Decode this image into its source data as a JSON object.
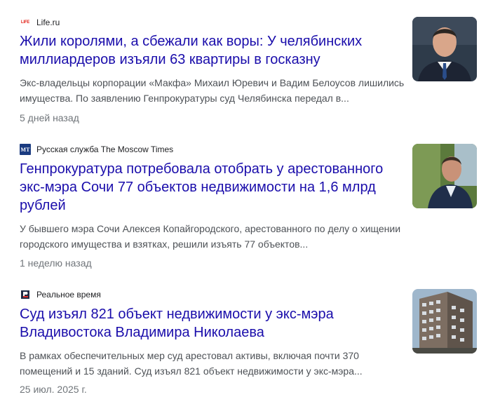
{
  "results": [
    {
      "source": "Life.ru",
      "logo_text": "LIFE",
      "title": "Жили королями, а сбежали как воры: У челябинских миллиардеров изъяли 63 квартиры в госказну",
      "snippet": "Экс-владельцы корпорации «Макфа» Михаил Юревич и Вадим Белоусов лишились имущества. По заявлению Генпрокуратуры суд Челябинска передал в...",
      "date": "5 дней назад"
    },
    {
      "source": "Русская служба The Moscow Times",
      "logo_text": "MT",
      "title": "Генпрокуратура потребовала отобрать у арестованного экс-мэра Сочи 77 объектов недвижимости на 1,6 млрд рублей",
      "snippet": "У бывшего мэра Сочи Алексея Копайгородского, арестованного по делу о хищении городского имущества и взятках, решили изъять 77 объектов...",
      "date": "1 неделю назад"
    },
    {
      "source": "Реальное время",
      "logo_text": "",
      "title": "Суд изъял 821 объект недвижимости у экс-мэра Владивостока Владимира Николаева",
      "snippet": "В рамках обеспечительных мер суд арестовал активы, включая почти 370 помещений и 15 зданий. Суд изъял 821 объект недвижимости у экс-мэра...",
      "date": "25 июл. 2025 г."
    }
  ]
}
